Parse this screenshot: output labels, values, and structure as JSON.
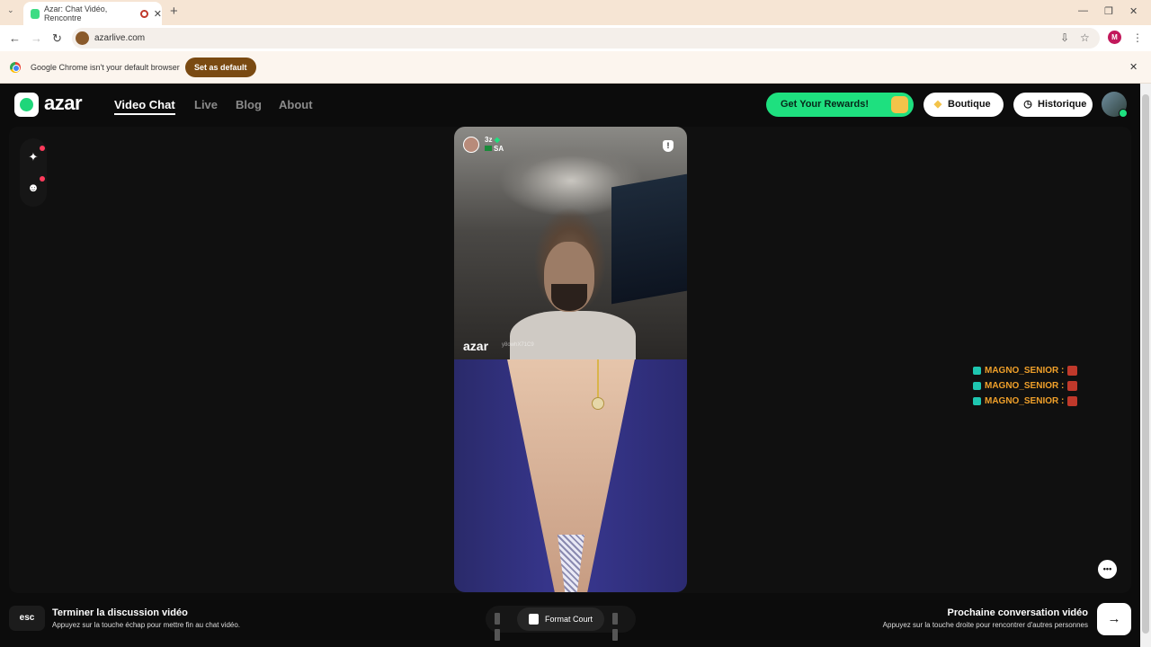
{
  "browser": {
    "tab_title": "Azar: Chat Vidéo, Rencontre",
    "url": "azarlive.com",
    "profile_initial": "M",
    "infobar_text": "Google Chrome isn't your default browser",
    "infobar_button": "Set as default"
  },
  "header": {
    "logo": "azar",
    "nav": [
      "Video Chat",
      "Live",
      "Blog",
      "About"
    ],
    "rewards_label": "Get Your Rewards!",
    "boutique_label": "Boutique",
    "history_label": "Historique"
  },
  "video": {
    "peer_name": "3z",
    "peer_country": "SA",
    "watermark": "azar",
    "watermark_id": "y8owhX71C9"
  },
  "chat": {
    "messages": [
      {
        "user": "MAGNO_SENIOR :"
      },
      {
        "user": "MAGNO_SENIOR :"
      },
      {
        "user": "MAGNO_SENIOR :"
      }
    ]
  },
  "footer": {
    "esc_key": "esc",
    "end_title": "Terminer la discussion vidéo",
    "end_sub": "Appuyez sur la touche échap pour mettre fin au chat vidéo.",
    "format_label": "Format Court",
    "next_title": "Prochaine conversation vidéo",
    "next_sub": "Appuyez sur la touche droite pour rencontrer d'autres personnes"
  },
  "colors": {
    "accent": "#1ee07f",
    "chat_name": "#f0a02a",
    "background": "#0c0c0c"
  }
}
